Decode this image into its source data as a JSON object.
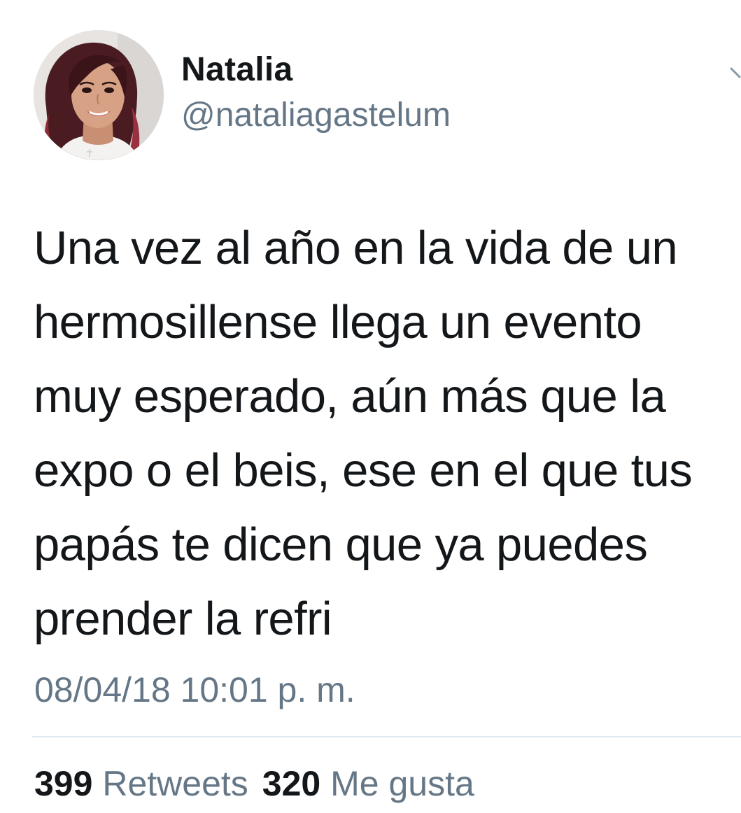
{
  "colors": {
    "text_primary": "#14171a",
    "text_secondary": "#657786",
    "divider": "#e1e8ed",
    "background": "#ffffff"
  },
  "author": {
    "name": "Natalia",
    "handle": "@nataliagastelum",
    "avatar": "profile-photo"
  },
  "menu": {
    "icon": "chevron-down-icon"
  },
  "tweet": {
    "lines": [
      "Una vez al año en la vida de un",
      "hermosillense llega un evento",
      "muy esperado, aún más que la",
      "expo o el beis, ese en el que tus",
      "papás te dicen que ya puedes",
      "prender la refri"
    ],
    "timestamp": "08/04/18 10:01 p. m."
  },
  "stats": {
    "retweets_count": "399",
    "retweets_label": "Retweets",
    "likes_count": "320",
    "likes_label": "Me gusta"
  }
}
